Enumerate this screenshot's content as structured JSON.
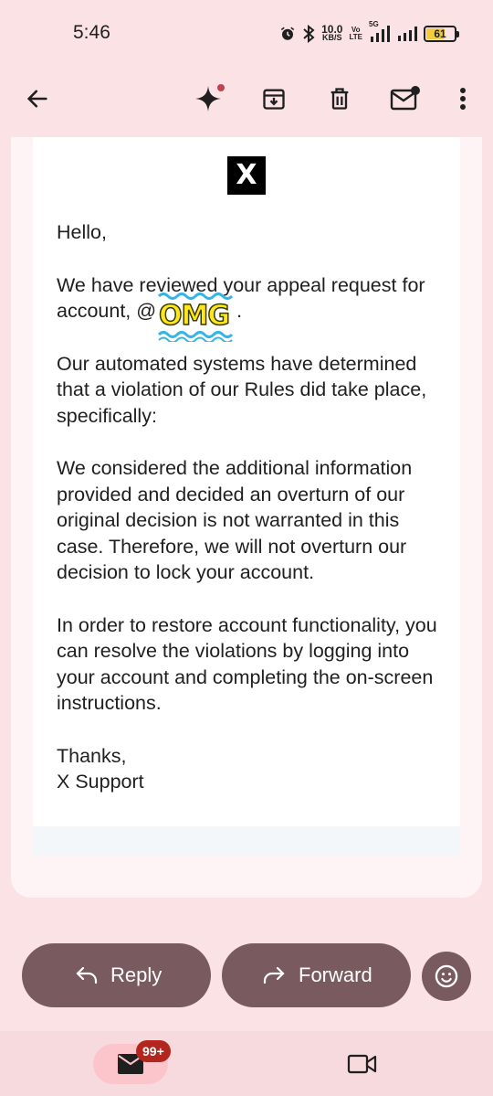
{
  "status_bar": {
    "time": "5:46",
    "net_speed_value": "10.0",
    "net_speed_unit": "KB/S",
    "volte_top": "Vo",
    "volte_bottom": "LTE",
    "network": "5G",
    "battery": "61",
    "battery_level": 0.61,
    "battery_color": "#f2cc3a"
  },
  "toolbar": {
    "icons": [
      "back-arrow-icon",
      "gemini-sparkle-icon",
      "archive-icon",
      "delete-icon",
      "mark-unread-icon",
      "more-vert-icon"
    ]
  },
  "email": {
    "sender_logo": "X",
    "greeting": "Hello,",
    "paragraph_1": "We have reviewed your appeal request for account, @",
    "handle_suffix": ".",
    "sticker_text": "OMG",
    "paragraph_2": "Our automated systems have determined that a violation of our Rules did take place, specifically:",
    "paragraph_3": "We considered the additional information provided and decided an overturn of our original decision is not warranted in this case. Therefore, we will not overturn our decision to lock your account.",
    "paragraph_4": "In order to restore account functionality, you can resolve the violations by logging into your account and completing the on-screen instructions.",
    "signoff": "Thanks,",
    "signature": "X Support"
  },
  "actions": {
    "reply_label": "Reply",
    "forward_label": "Forward"
  },
  "bottom_nav": {
    "mail_badge": "99+"
  },
  "colors": {
    "background": "#fbe3e5",
    "action_button": "#785a5f",
    "badge": "#b3261e",
    "sticker_fill": "#ffe81a",
    "sticker_wave": "#33b5e5"
  }
}
